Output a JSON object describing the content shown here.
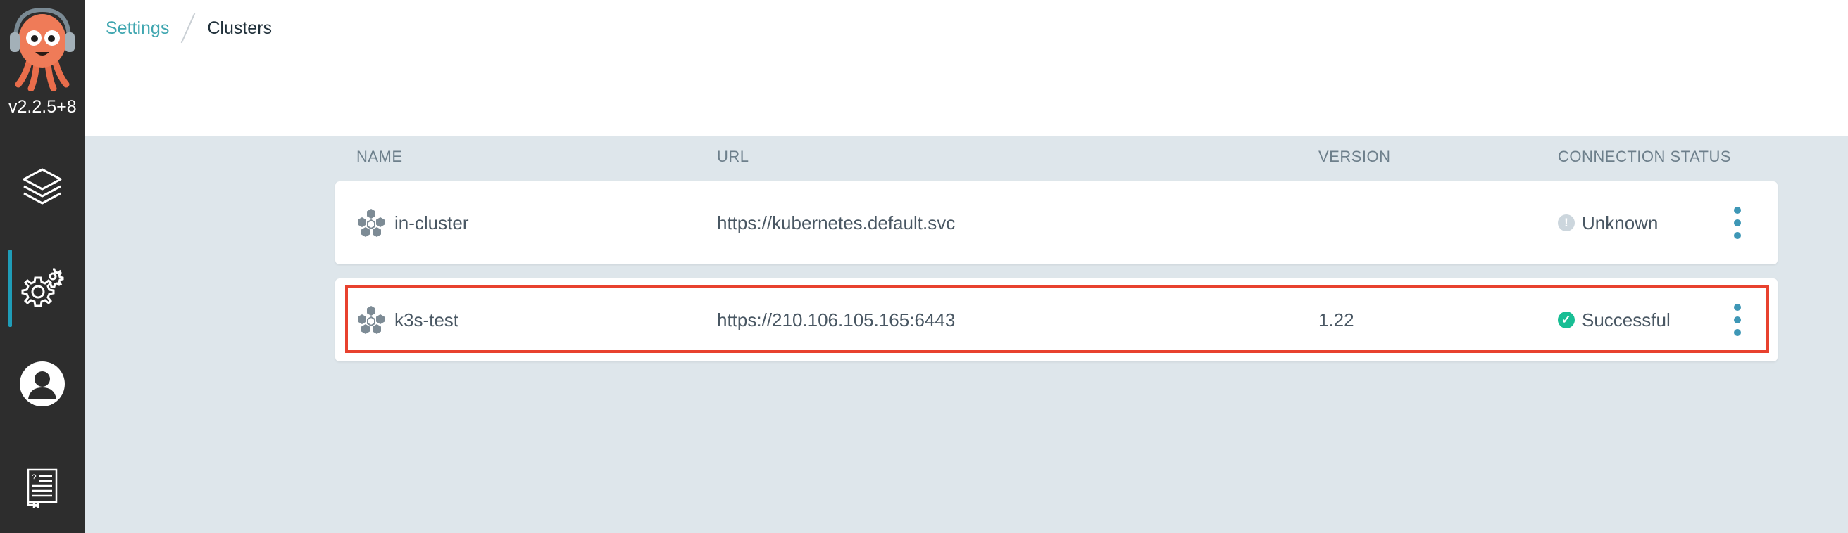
{
  "app": {
    "version": "v2.2.5+8",
    "logo_icon": "argo-octopus-logo"
  },
  "sidebar": {
    "items": [
      {
        "name": "applications",
        "icon": "layers-icon",
        "active": false
      },
      {
        "name": "settings",
        "icon": "gear-icon",
        "active": true
      },
      {
        "name": "user-info",
        "icon": "user-icon",
        "active": false
      },
      {
        "name": "documentation",
        "icon": "docs-icon",
        "active": false
      }
    ]
  },
  "breadcrumb": {
    "parent": "Settings",
    "current": "Clusters"
  },
  "table": {
    "columns": [
      "NAME",
      "URL",
      "VERSION",
      "CONNECTION STATUS"
    ],
    "rows": [
      {
        "name": "in-cluster",
        "url": "https://kubernetes.default.svc",
        "version": "",
        "status": "Unknown",
        "status_icon": "info-icon",
        "status_color": "#ccd6dd",
        "highlighted": false
      },
      {
        "name": "k3s-test",
        "url": "https://210.106.105.165:6443",
        "version": "1.22",
        "status": "Successful",
        "status_icon": "check-circle-icon",
        "status_color": "#18be94",
        "highlighted": true
      }
    ]
  },
  "colors": {
    "sidebar_bg": "#2d2d2d",
    "accent": "#1f9db8",
    "link": "#3fa6b0",
    "highlight_border": "#e8412e",
    "content_bg": "#dee6eb"
  }
}
